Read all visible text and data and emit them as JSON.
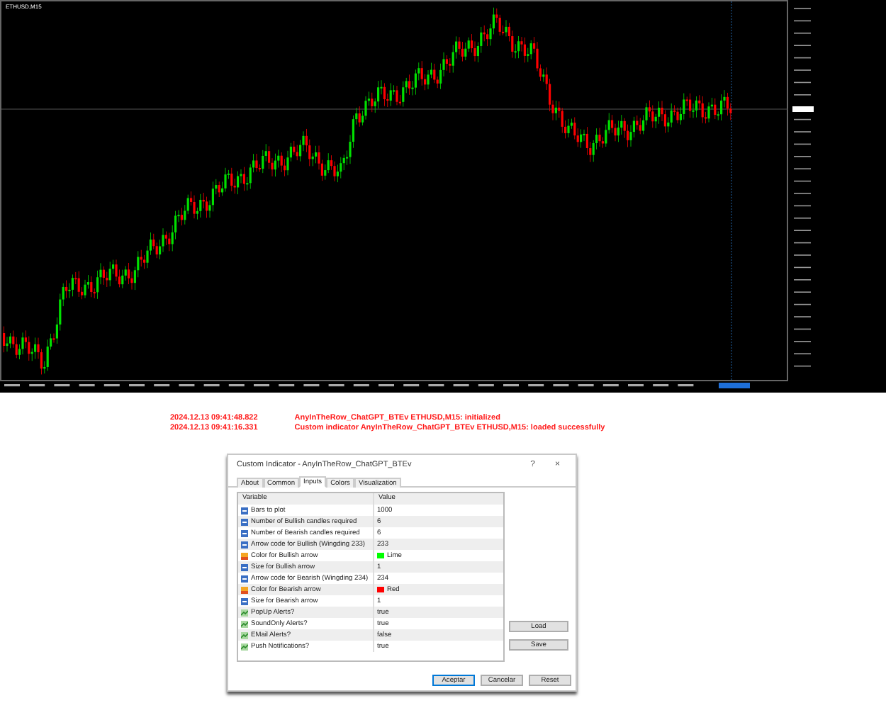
{
  "chart": {
    "symbol": "ETHUSD,M15"
  },
  "journal": [
    {
      "time": "2024.12.13 09:41:48.822",
      "message": "AnyInTheRow_ChatGPT_BTEv ETHUSD,M15: initialized"
    },
    {
      "time": "2024.12.13 09:41:16.331",
      "message": "Custom indicator AnyInTheRow_ChatGPT_BTEv ETHUSD,M15: loaded successfully"
    }
  ],
  "dialog": {
    "title": "Custom Indicator - AnyInTheRow_ChatGPT_BTEv",
    "help": "?",
    "close": "×",
    "tabs": [
      {
        "label": "About",
        "selected": false
      },
      {
        "label": "Common",
        "selected": false
      },
      {
        "label": "Inputs",
        "selected": true
      },
      {
        "label": "Colors",
        "selected": false
      },
      {
        "label": "Visualization",
        "selected": false
      }
    ],
    "columns": [
      "Variable",
      "Value"
    ],
    "rows": [
      {
        "kind": "number",
        "variable": "Bars to plot",
        "value": "1000"
      },
      {
        "kind": "number",
        "variable": "Number of Bullish candles required",
        "value": "6"
      },
      {
        "kind": "number",
        "variable": "Number of Bearish candles required",
        "value": "6"
      },
      {
        "kind": "number",
        "variable": "Arrow code for Bullish (Wingding 233)",
        "value": "233"
      },
      {
        "kind": "color",
        "variable": "Color for Bullish arrow",
        "value": "Lime",
        "color": "#00ff00"
      },
      {
        "kind": "number",
        "variable": "Size for Bullish arrow",
        "value": "1"
      },
      {
        "kind": "number",
        "variable": "Arrow code for Bearish (Wingding 234)",
        "value": "234"
      },
      {
        "kind": "color",
        "variable": "Color for Bearish arrow",
        "value": "Red",
        "color": "#ff0000"
      },
      {
        "kind": "number",
        "variable": "Size for Bearish arrow",
        "value": "1"
      },
      {
        "kind": "bool",
        "variable": "PopUp Alerts?",
        "value": "true"
      },
      {
        "kind": "bool",
        "variable": "SoundOnly Alerts?",
        "value": "true"
      },
      {
        "kind": "bool",
        "variable": "EMail Alerts?",
        "value": "false"
      },
      {
        "kind": "bool",
        "variable": "Push Notifications?",
        "value": "true"
      }
    ],
    "side_buttons": [
      "Load",
      "Save"
    ],
    "buttons": [
      {
        "label": "Aceptar",
        "default": true
      },
      {
        "label": "Cancelar",
        "default": false
      },
      {
        "label": "Reset",
        "default": false
      }
    ]
  }
}
